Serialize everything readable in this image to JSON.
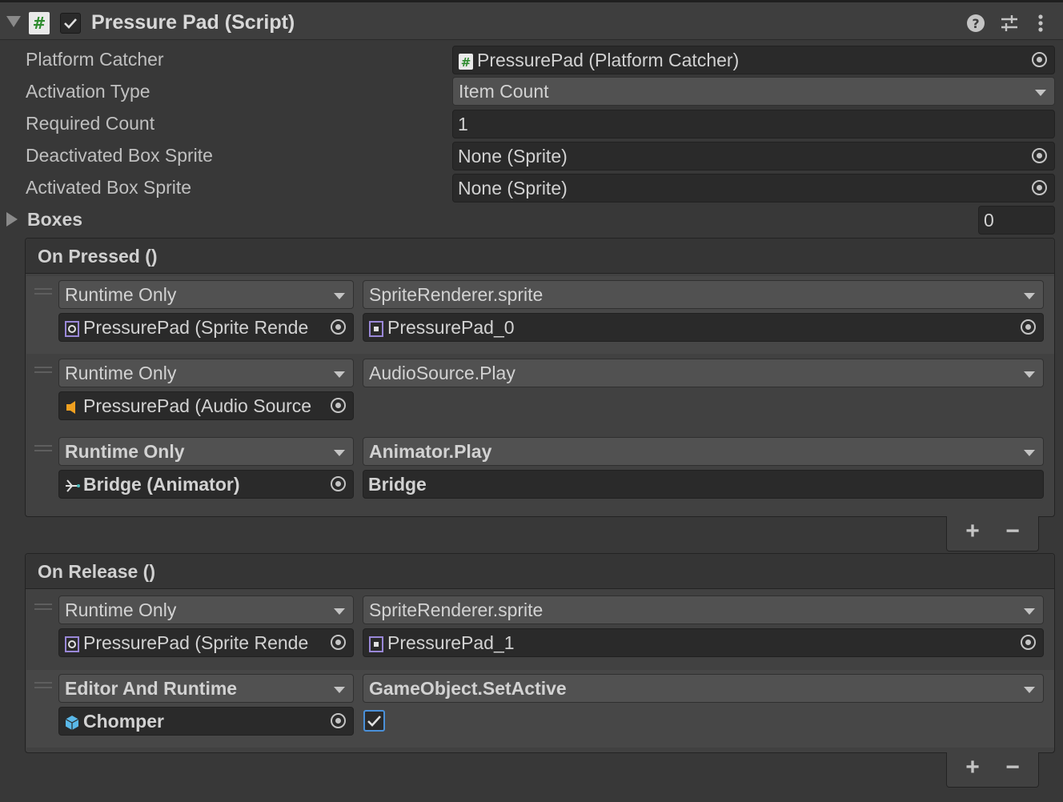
{
  "component": {
    "title": "Pressure Pad (Script)",
    "enabled": true,
    "icons": [
      "help-icon",
      "preset-icon",
      "kebab-menu-icon"
    ]
  },
  "properties": {
    "platform_catcher": {
      "label": "Platform Catcher",
      "value": "PressurePad (Platform Catcher)"
    },
    "activation_type": {
      "label": "Activation Type",
      "value": "Item Count"
    },
    "required_count": {
      "label": "Required Count",
      "value": "1"
    },
    "deactivated_box_sprite": {
      "label": "Deactivated Box Sprite",
      "value": "None (Sprite)"
    },
    "activated_box_sprite": {
      "label": "Activated Box Sprite",
      "value": "None (Sprite)"
    },
    "boxes": {
      "label": "Boxes",
      "size": "0"
    }
  },
  "on_pressed": {
    "title": "On Pressed ()",
    "entries": [
      {
        "mode": "Runtime Only",
        "target": "PressurePad (Sprite Rende",
        "function": "SpriteRenderer.sprite",
        "argument": "PressurePad_0"
      },
      {
        "mode": "Runtime Only",
        "target": "PressurePad (Audio Source",
        "function": "AudioSource.Play",
        "argument": ""
      },
      {
        "mode": "Runtime Only",
        "target": "Bridge (Animator)",
        "function": "Animator.Play",
        "argument": "Bridge"
      }
    ]
  },
  "on_release": {
    "title": "On Release ()",
    "entries": [
      {
        "mode": "Runtime Only",
        "target": "PressurePad (Sprite Rende",
        "function": "SpriteRenderer.sprite",
        "argument": "PressurePad_1"
      },
      {
        "mode": "Editor And Runtime",
        "target": "Chomper",
        "function": "GameObject.SetActive",
        "argument_checked": true
      }
    ]
  },
  "list_buttons": {
    "add": "+",
    "remove": "−"
  },
  "colors": {
    "panel_bg": "#383838",
    "field_bg": "#2a2a2a",
    "popup_bg": "#515151",
    "accent_blue": "#4a90d9",
    "script_green": "#2e8b2e"
  }
}
